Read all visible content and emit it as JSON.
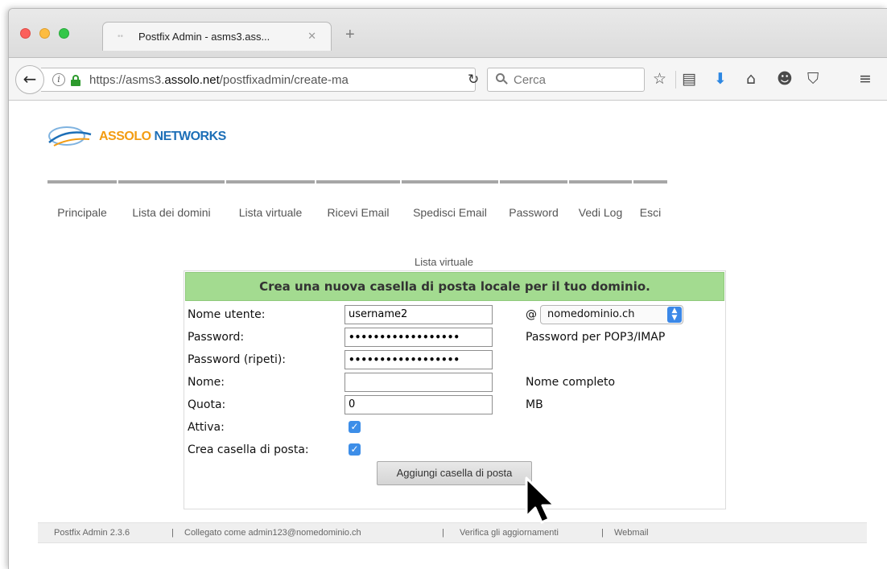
{
  "browser": {
    "tab_title": "Postfix Admin - asms3.ass...",
    "tab_favicon": "loading-dots-icon",
    "tab_close": "✕",
    "new_tab": "+",
    "url_prefix": "https://asms3.",
    "url_domain": "assolo.net",
    "url_path": "/postfixadmin/create-ma",
    "search_placeholder": "Cerca",
    "toolbar_icons": [
      "star-icon",
      "reading-list-icon",
      "download-icon",
      "home-icon",
      "hello-icon",
      "pocket-icon",
      "menu-icon"
    ]
  },
  "logo": {
    "brand_blue": "ASSOLO",
    "brand_orange": " NETWORKS"
  },
  "menu": {
    "items": [
      {
        "label": "Principale"
      },
      {
        "label": "Lista dei domini"
      },
      {
        "label": "Lista virtuale"
      },
      {
        "label": "Ricevi Email"
      },
      {
        "label": "Spedisci Email"
      },
      {
        "label": "Password"
      },
      {
        "label": "Vedi Log"
      },
      {
        "label": "Esci"
      }
    ]
  },
  "section_label": "Lista virtuale",
  "form": {
    "header": "Crea una nuova casella di posta locale per il tuo dominio.",
    "rows": [
      {
        "label": "Nome utente:",
        "value": "username2"
      },
      {
        "label": "Password:",
        "value": "••••••••••••••••••",
        "note": "Password per POP3/IMAP"
      },
      {
        "label": "Password (ripeti):",
        "value": "••••••••••••••••••"
      },
      {
        "label": "Nome:",
        "value": "",
        "note": "Nome completo"
      },
      {
        "label": "Quota:",
        "value": "0",
        "note": "MB"
      },
      {
        "label": "Attiva:",
        "checked": true
      },
      {
        "label": "Crea casella di posta:",
        "checked": true
      }
    ],
    "at_sign": "@",
    "domain_selected": "nomedominio.ch",
    "submit_label": "Aggiungi casella di posta"
  },
  "footer": {
    "version": "Postfix Admin 2.3.6",
    "sep1": "|",
    "logged_in": "Collegato come admin123@nomedominio.ch",
    "sep2": "|",
    "check_updates": "Verifica gli aggiornamenti",
    "sep3": "|",
    "webmail": "Webmail"
  },
  "colors": {
    "header_green": "#a3db90",
    "checkbox_blue": "#3d8ee8",
    "logo_blue": "#1d6fb7",
    "logo_orange": "#f39c12"
  }
}
